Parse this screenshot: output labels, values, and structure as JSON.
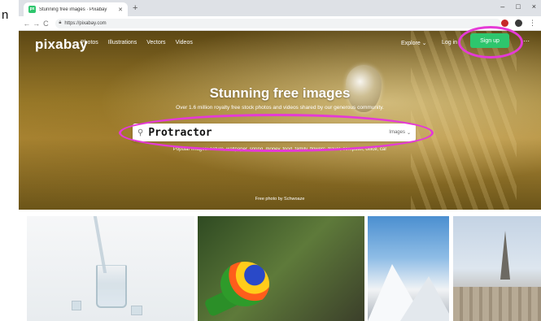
{
  "margin": {
    "glyph": "n"
  },
  "browser": {
    "tab_title": "Stunning free images · Pixabay",
    "favicon_text": "px",
    "url": "https://pixabay.com",
    "window_controls": {
      "minimize": "–",
      "maximize": "□",
      "close": "×"
    },
    "nav": {
      "back": "←",
      "forward": "→",
      "reload": "C"
    }
  },
  "header": {
    "logo": "pixabay",
    "nav": [
      "Photos",
      "Illustrations",
      "Vectors",
      "Videos"
    ],
    "explore": "Explore ⌄",
    "login": "Log in",
    "signup": "Sign up",
    "more": "⋯"
  },
  "hero": {
    "title": "Stunning free images",
    "subtitle": "Over 1.6 million royalty free stock photos and videos shared by our generous community.",
    "search_value": "Protractor",
    "search_type": "Images",
    "popular": "Popular images: nature, wallpaper, spring, money, food, family, flowers, travel, computer, office, car",
    "credit": "Free photo by Schwoaze"
  },
  "annotations": {
    "color": "#e53ad6"
  },
  "icons": {
    "search": "search-icon",
    "lock": "lock-icon",
    "chevron": "chevron-down-icon"
  },
  "colors": {
    "accent": "#2ec66d"
  }
}
